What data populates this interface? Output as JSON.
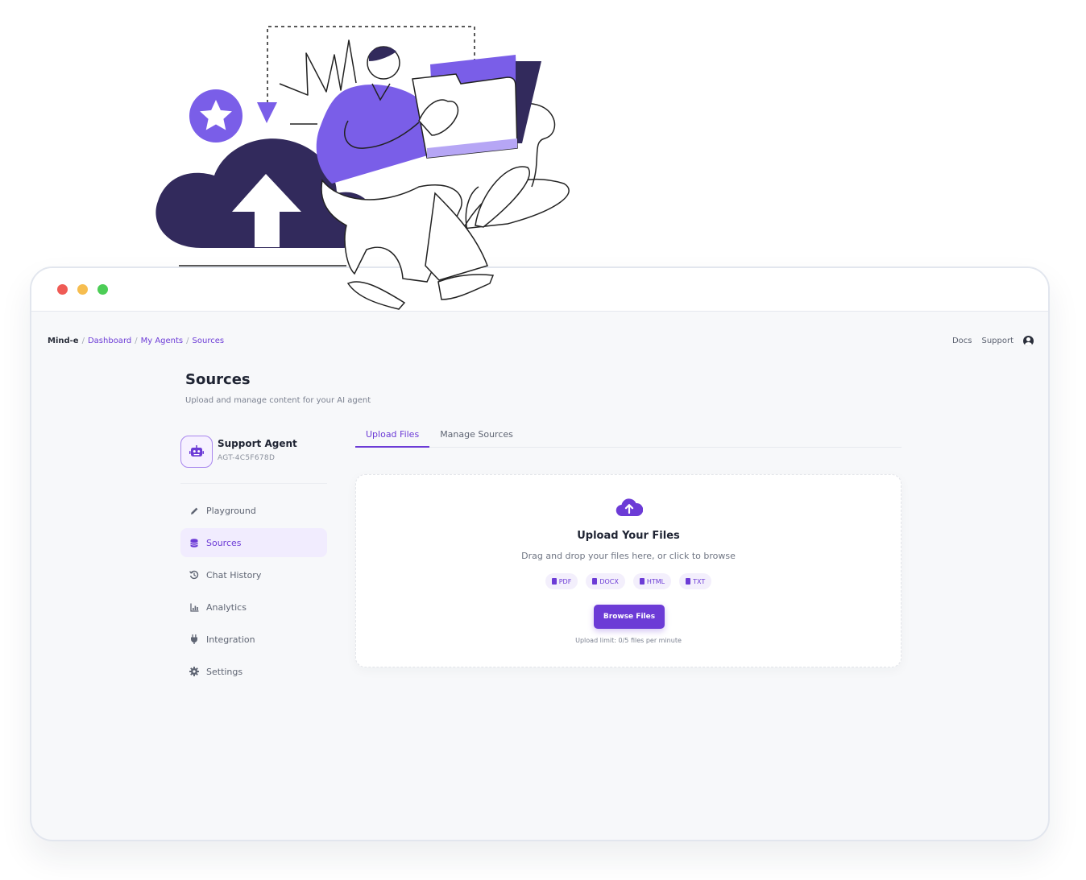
{
  "breadcrumb": {
    "brand": "Mind-e",
    "items": [
      "Dashboard",
      "My Agents",
      "Sources"
    ],
    "separator": "/"
  },
  "topnav": {
    "docs": "Docs",
    "support": "Support",
    "user_icon": "user-circle-icon"
  },
  "page": {
    "title": "Sources",
    "subtitle": "Upload and manage content for your AI agent"
  },
  "agent": {
    "name": "Support Agent",
    "id": "AGT-4C5F678D",
    "icon": "robot-icon"
  },
  "sidebar": {
    "items": [
      {
        "label": "Playground",
        "icon": "pencil-icon",
        "active": false
      },
      {
        "label": "Sources",
        "icon": "database-icon",
        "active": true
      },
      {
        "label": "Chat History",
        "icon": "history-icon",
        "active": false
      },
      {
        "label": "Analytics",
        "icon": "chart-icon",
        "active": false
      },
      {
        "label": "Integration",
        "icon": "plug-icon",
        "active": false
      },
      {
        "label": "Settings",
        "icon": "gear-icon",
        "active": false
      }
    ]
  },
  "tabs": [
    {
      "label": "Upload Files",
      "active": true
    },
    {
      "label": "Manage Sources",
      "active": false
    }
  ],
  "upload": {
    "title": "Upload Your Files",
    "description": "Drag and drop your files here, or click to browse",
    "file_types": [
      "PDF",
      "DOCX",
      "HTML",
      "TXT"
    ],
    "button": "Browse Files",
    "limit": "Upload limit: 0/5 files per minute"
  },
  "colors": {
    "accent": "#6c3bd6",
    "illustration_dark": "#322a5c",
    "illustration_purple": "#7a5ee8"
  }
}
